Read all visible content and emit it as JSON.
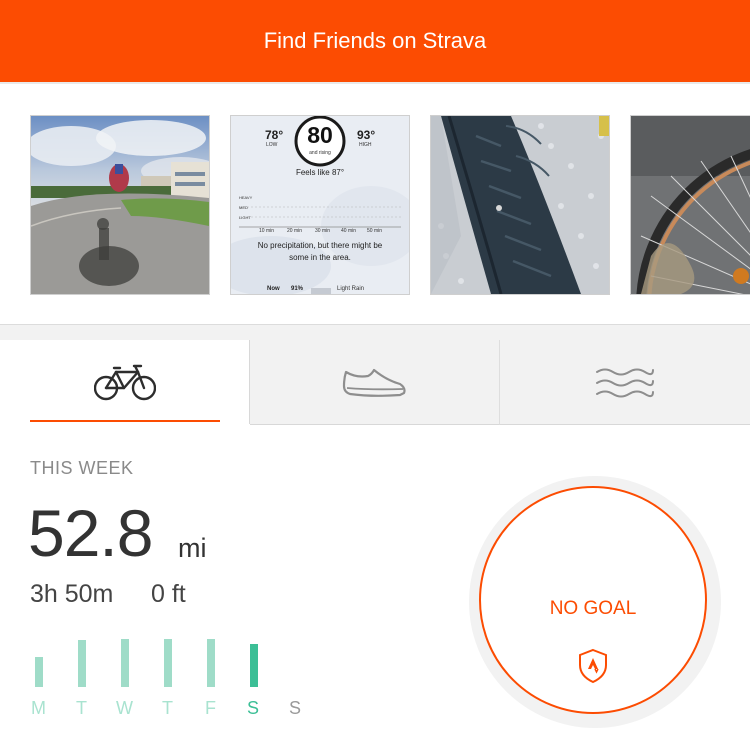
{
  "header": {
    "title": "Find Friends on Strava",
    "accent": "#fc4c02"
  },
  "photos": {
    "weather_card": {
      "low_temp": "78°",
      "low_label": "LOW",
      "current_temp": "80",
      "current_sub": "and rising",
      "high_temp": "93°",
      "high_label": "HIGH",
      "feels_like": "Feels like 87°",
      "levels": [
        "HEAVY",
        "MED",
        "LIGHT"
      ],
      "times": [
        "10 min",
        "20 min",
        "30 min",
        "40 min",
        "50 min"
      ],
      "forecast_line1": "No precipitation, but there might be",
      "forecast_line2": "some in the area.",
      "now_label": "Now",
      "now_pct": "91%",
      "now_desc": "Light Rain"
    }
  },
  "tabs": [
    {
      "name": "ride",
      "icon": "bike-icon",
      "active": true
    },
    {
      "name": "run",
      "icon": "shoe-icon",
      "active": false
    },
    {
      "name": "swim",
      "icon": "waves-icon",
      "active": false
    }
  ],
  "stats": {
    "week_label": "THIS WEEK",
    "distance": "52.8",
    "distance_unit": "mi",
    "time": "3h 50m",
    "elevation": "0 ft"
  },
  "week_chart": {
    "days": [
      "M",
      "T",
      "W",
      "T",
      "F",
      "S",
      "S"
    ],
    "today_index": 5,
    "bar_color": "#9fdcc8",
    "today_color": "#3cbf96",
    "label_color": "#a9e3d0",
    "future_label_color": "#9a9a9a"
  },
  "goal": {
    "label": "NO GOAL",
    "icon": "shield-icon"
  }
}
